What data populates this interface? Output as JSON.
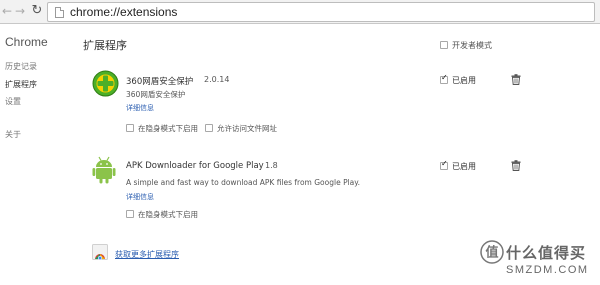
{
  "browser": {
    "url": "chrome://extensions"
  },
  "sidebar": {
    "title": "Chrome",
    "items": [
      {
        "label": "历史记录"
      },
      {
        "label": "扩展程序"
      },
      {
        "label": "设置"
      },
      {
        "label": "关于"
      }
    ]
  },
  "header": {
    "title": "扩展程序",
    "dev_mode_label": "开发者模式",
    "dev_mode_checked": false
  },
  "extensions": [
    {
      "name": "360网盾安全保护",
      "version": "2.0.14",
      "description": "360网盾安全保护",
      "details_link": "详细信息",
      "options": [
        "在隐身模式下启用",
        "允许访问文件网址"
      ],
      "enabled_label": "已启用",
      "enabled": true,
      "icon": "360-shield-icon"
    },
    {
      "name": "APK Downloader for Google Play",
      "version": "1.8",
      "description": "A simple and fast way to download APK files from Google Play.",
      "details_link": "详细信息",
      "options": [
        "在隐身模式下启用"
      ],
      "enabled_label": "已启用",
      "enabled": true,
      "icon": "android-robot-icon"
    }
  ],
  "get_more": {
    "label": "获取更多扩展程序",
    "icon": "chrome-webstore-icon"
  },
  "watermark": {
    "name": "什么值得买",
    "domain": "SMZDM.COM"
  },
  "colors": {
    "link": "#2a5db0",
    "shield_green": "#4caf28",
    "shield_yellow": "#f5d200",
    "android_green": "#8bc34a"
  }
}
